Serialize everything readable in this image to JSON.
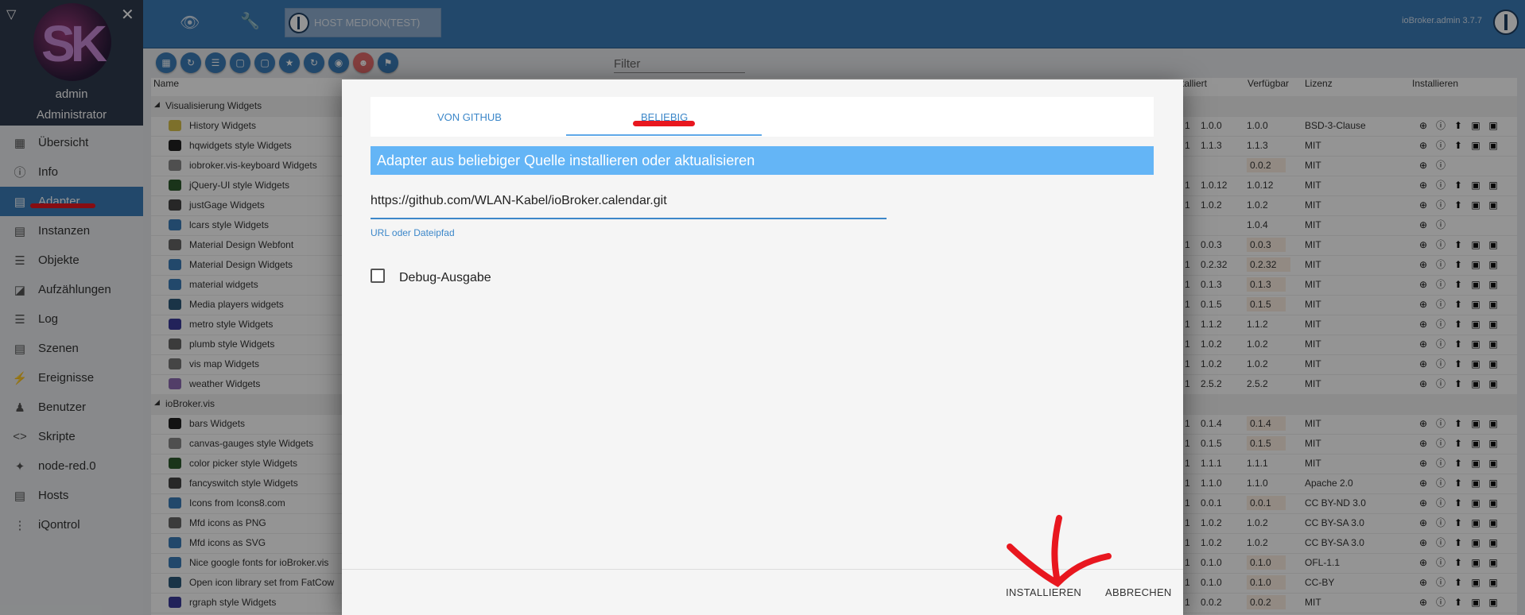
{
  "topbar": {
    "host_label": "HOST MEDION(TEST)",
    "version": "ioBroker.admin 3.7.7"
  },
  "sidebar": {
    "user_name": "admin",
    "user_role": "Administrator",
    "avatar_text": "SK",
    "items": [
      {
        "label": "Übersicht",
        "icon": "grid-icon"
      },
      {
        "label": "Info",
        "icon": "info-icon"
      },
      {
        "label": "Adapter",
        "icon": "store-icon"
      },
      {
        "label": "Instanzen",
        "icon": "instances-icon"
      },
      {
        "label": "Objekte",
        "icon": "list-icon"
      },
      {
        "label": "Aufzählungen",
        "icon": "enum-icon"
      },
      {
        "label": "Log",
        "icon": "log-icon"
      },
      {
        "label": "Szenen",
        "icon": "scenes-icon"
      },
      {
        "label": "Ereignisse",
        "icon": "bolt-icon"
      },
      {
        "label": "Benutzer",
        "icon": "user-icon"
      },
      {
        "label": "Skripte",
        "icon": "code-icon"
      },
      {
        "label": "node-red.0",
        "icon": "node-red-icon"
      },
      {
        "label": "Hosts",
        "icon": "hosts-icon"
      },
      {
        "label": "iQontrol",
        "icon": "iqontrol-icon"
      }
    ],
    "active_index": 2
  },
  "filter": {
    "placeholder": "Filter"
  },
  "table": {
    "headers": {
      "name": "Name",
      "installed": "stalliert",
      "available": "Verfügbar",
      "license": "Lizenz",
      "install": "Installieren"
    },
    "rows": [
      {
        "type": "group",
        "name": "Visualisierung Widgets"
      },
      {
        "name": "History Widgets",
        "installed": "1.0.0",
        "available": "1.0.0",
        "license": "BSD-3-Clause"
      },
      {
        "name": "hqwidgets style Widgets",
        "installed": "1.1.3",
        "available": "1.1.3",
        "license": "MIT"
      },
      {
        "name": "iobroker.vis-keyboard Widgets",
        "installed": "",
        "available": "0.0.2",
        "license": "MIT",
        "hl": true
      },
      {
        "name": "jQuery-UI style Widgets",
        "installed": "1.0.12",
        "available": "1.0.12",
        "license": "MIT"
      },
      {
        "name": "justGage Widgets",
        "installed": "1.0.2",
        "available": "1.0.2",
        "license": "MIT"
      },
      {
        "name": "lcars style Widgets",
        "installed": "",
        "available": "1.0.4",
        "license": "MIT"
      },
      {
        "name": "Material Design Webfont",
        "installed": "0.0.3",
        "available": "0.0.3",
        "license": "MIT",
        "hl": true
      },
      {
        "name": "Material Design Widgets",
        "installed": "0.2.32",
        "available": "0.2.32",
        "license": "MIT",
        "hl": true
      },
      {
        "name": "material widgets",
        "installed": "0.1.3",
        "available": "0.1.3",
        "license": "MIT",
        "hl": true
      },
      {
        "name": "Media players widgets",
        "installed": "0.1.5",
        "available": "0.1.5",
        "license": "MIT",
        "hl": true
      },
      {
        "name": "metro style Widgets",
        "installed": "1.1.2",
        "available": "1.1.2",
        "license": "MIT"
      },
      {
        "name": "plumb style Widgets",
        "installed": "1.0.2",
        "available": "1.0.2",
        "license": "MIT"
      },
      {
        "name": "vis map Widgets",
        "installed": "1.0.2",
        "available": "1.0.2",
        "license": "MIT"
      },
      {
        "name": "weather Widgets",
        "installed": "2.5.2",
        "available": "2.5.2",
        "license": "MIT"
      },
      {
        "type": "group",
        "name": "ioBroker.vis"
      },
      {
        "name": "bars Widgets",
        "installed": "0.1.4",
        "available": "0.1.4",
        "license": "MIT",
        "hl": true
      },
      {
        "name": "canvas-gauges style Widgets",
        "installed": "0.1.5",
        "available": "0.1.5",
        "license": "MIT",
        "hl": true
      },
      {
        "name": "color picker style Widgets",
        "installed": "1.1.1",
        "available": "1.1.1",
        "license": "MIT"
      },
      {
        "name": "fancyswitch style Widgets",
        "installed": "1.1.0",
        "available": "1.1.0",
        "license": "Apache 2.0"
      },
      {
        "name": "Icons from Icons8.com",
        "installed": "0.0.1",
        "available": "0.0.1",
        "license": "CC BY-ND 3.0",
        "hl": true
      },
      {
        "name": "Mfd icons as PNG",
        "installed": "1.0.2",
        "available": "1.0.2",
        "license": "CC BY-SA 3.0"
      },
      {
        "name": "Mfd icons as SVG",
        "installed": "1.0.2",
        "available": "1.0.2",
        "license": "CC BY-SA 3.0"
      },
      {
        "name": "Nice google fonts for ioBroker.vis",
        "installed": "0.1.0",
        "available": "0.1.0",
        "license": "OFL-1.1",
        "hl": true
      },
      {
        "name": "Open icon library set from FatCow",
        "installed": "0.1.0",
        "available": "0.1.0",
        "license": "CC-BY",
        "hl": true
      },
      {
        "name": "rgraph style Widgets",
        "installed": "0.0.2",
        "available": "0.0.2",
        "license": "MIT",
        "hl": true
      }
    ]
  },
  "dialog": {
    "tab_github": "VON GITHUB",
    "tab_any": "BELIEBIG",
    "title": "Adapter aus beliebiger Quelle installieren oder aktualisieren",
    "url_value": "https://github.com/WLAN-Kabel/ioBroker.calendar.git",
    "url_label": "URL oder Dateipfad",
    "debug_label": "Debug-Ausgabe",
    "install_button": "INSTALLIEREN",
    "cancel_button": "ABBRECHEN"
  },
  "colors": {
    "primary": "#3c7cb8",
    "dialog_title": "#64b5f6",
    "annotation": "#e8171f"
  }
}
